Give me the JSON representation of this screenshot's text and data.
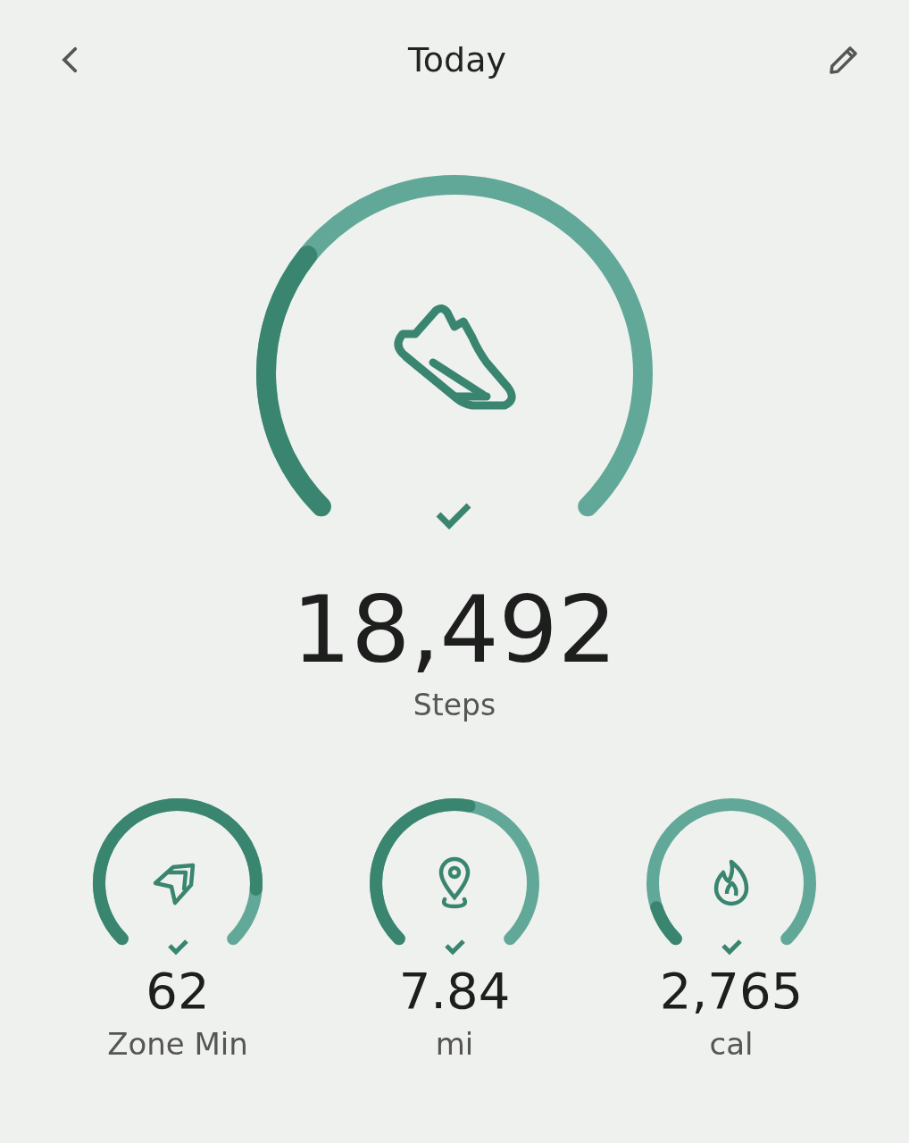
{
  "header": {
    "title": "Today"
  },
  "main": {
    "value": "18,492",
    "label": "Steps",
    "goal_met": true
  },
  "metrics": [
    {
      "kind": "zone",
      "value": "62",
      "label": "Zone Min",
      "goal_met": true
    },
    {
      "kind": "distance",
      "value": "7.84",
      "label": "mi",
      "goal_met": true
    },
    {
      "kind": "calories",
      "value": "2,765",
      "label": "cal",
      "goal_met": true
    }
  ]
}
